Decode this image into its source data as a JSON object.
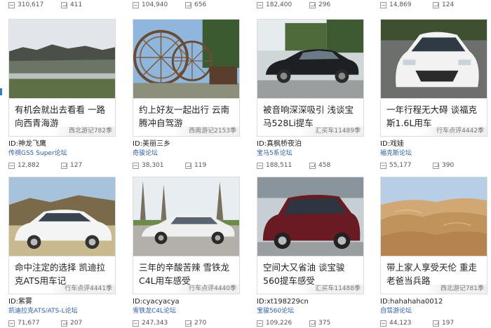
{
  "top_stats": [
    {
      "views": "310,617",
      "comments": "411"
    },
    {
      "views": "104,940",
      "comments": "656"
    },
    {
      "views": "182,400",
      "comments": "296"
    },
    {
      "views": "14,869",
      "comments": "124"
    }
  ],
  "cards": [
    {
      "title": "有机会就出去看看 一路向西青海游",
      "tag": "西北游记782季",
      "author": "ID:神龙飞鹰",
      "forum": "传祺GS5 Super论坛",
      "views": "12,882",
      "comments": "127",
      "image": "mountain-lake-photo"
    },
    {
      "title": "约上好友一起出行 云南腾冲自驾游",
      "tag": "西南游记2153季",
      "author": "ID:美丽三乡",
      "forum": "奇骏论坛",
      "views": "38,301",
      "comments": "119",
      "image": "waterwheel-photo"
    },
    {
      "title": "被音响深深吸引 浅谈宝马528Li提车",
      "tag": "汇买车11489季",
      "author": "ID:真枫桥夜泊",
      "forum": "宝马5系论坛",
      "views": "188,511",
      "comments": "458",
      "image": "black-sedan-photo"
    },
    {
      "title": "一年行程无大碍 谈福克斯1.6L用车",
      "tag": "行车点评4442季",
      "author": "ID:戏娃",
      "forum": "福克斯论坛",
      "views": "55,177",
      "comments": "390",
      "image": "white-hatchback-photo"
    },
    {
      "title": "命中注定的选择 凯迪拉克ATS用车记",
      "tag": "行车点评4441季",
      "author": "ID:紫雾",
      "forum": "凯迪拉克ATS/ATS-L论坛",
      "views": "71,677",
      "comments": "207",
      "image": "white-cadillac-photo"
    },
    {
      "title": "三年的辛酸苦辣 雪铁龙C4L用车感受",
      "tag": "行车点评4440季",
      "author": "ID:cyacyacya",
      "forum": "雪铁龙C4L论坛",
      "views": "247,343",
      "comments": "270",
      "image": "white-sedan-trees-photo"
    },
    {
      "title": "空间大又省油 谈宝骏560提车感受",
      "tag": "汇买车11488季",
      "author": "ID:xt198229cn",
      "forum": "宝骏560论坛",
      "views": "109,226",
      "comments": "375",
      "image": "red-suv-photo"
    },
    {
      "title": "带上家人享受天伦 重走老爸当兵路",
      "tag": "西北游记781季",
      "author": "ID:hahahaha0012",
      "forum": "自驾游论坛",
      "views": "44,123",
      "comments": "197",
      "image": "desert-dunes-photo"
    }
  ]
}
